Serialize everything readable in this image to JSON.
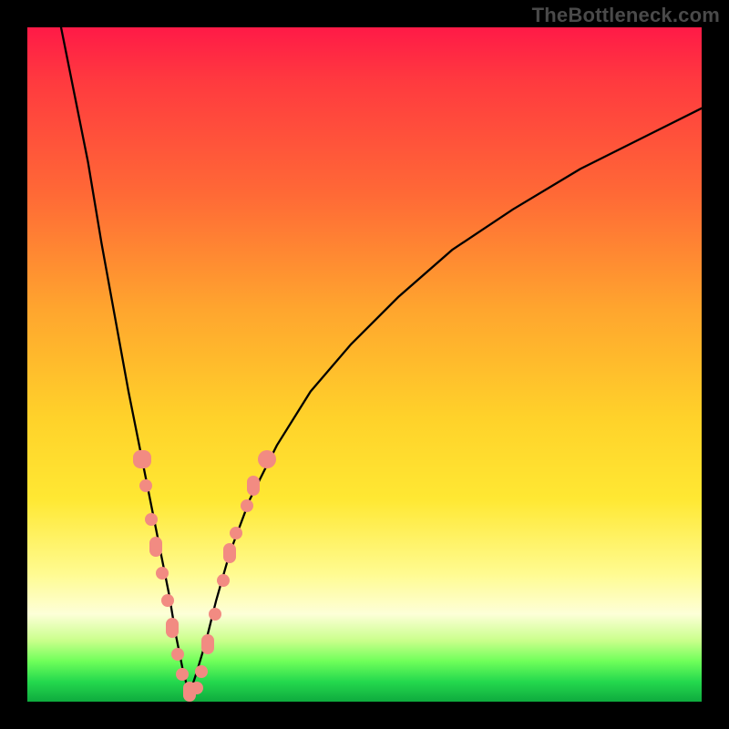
{
  "watermark": "TheBottleneck.com",
  "colors": {
    "frame": "#000000",
    "curve": "#000000",
    "dot": "#f28b82",
    "gradient_stops": [
      "#ff1a47",
      "#ff3a3f",
      "#ff6a36",
      "#ffa62e",
      "#ffd22a",
      "#ffe833",
      "#fffb90",
      "#fdffd8",
      "#c9ff8a",
      "#6fff5a",
      "#25d94e",
      "#0eab3e"
    ]
  },
  "chart_data": {
    "type": "line",
    "title": "",
    "xlabel": "",
    "ylabel": "",
    "xlim": [
      0,
      100
    ],
    "ylim": [
      0,
      100
    ],
    "legend": false,
    "grid": false,
    "notes": "Bottleneck curve: two arms descend to a narrow V at x≈24. Y-axis is bottleneck %, 0 at bottom (green). Salmon markers cluster on both arms below y≈35.",
    "series": [
      {
        "name": "curve_left",
        "x": [
          5,
          7,
          9,
          11,
          13,
          15,
          17,
          18,
          19,
          20,
          21,
          22,
          23,
          24
        ],
        "y": [
          100,
          90,
          80,
          68,
          57,
          46,
          36,
          31,
          26,
          21,
          16,
          10,
          5,
          1
        ]
      },
      {
        "name": "curve_right",
        "x": [
          24,
          25,
          26.5,
          28,
          30,
          33,
          37,
          42,
          48,
          55,
          63,
          72,
          82,
          92,
          100
        ],
        "y": [
          1,
          4,
          9,
          15,
          22,
          30,
          38,
          46,
          53,
          60,
          67,
          73,
          79,
          84,
          88
        ]
      }
    ],
    "markers": [
      {
        "series": "left",
        "x": 17.0,
        "y": 36
      },
      {
        "series": "left",
        "x": 17.5,
        "y": 32
      },
      {
        "series": "left",
        "x": 18.4,
        "y": 27
      },
      {
        "series": "left",
        "x": 19.0,
        "y": 23
      },
      {
        "series": "left",
        "x": 20.0,
        "y": 19
      },
      {
        "series": "left",
        "x": 20.8,
        "y": 15
      },
      {
        "series": "left",
        "x": 21.5,
        "y": 11
      },
      {
        "series": "left",
        "x": 22.3,
        "y": 7
      },
      {
        "series": "left",
        "x": 23.0,
        "y": 4
      },
      {
        "series": "left",
        "x": 24.0,
        "y": 1.5
      },
      {
        "series": "right",
        "x": 25.2,
        "y": 2
      },
      {
        "series": "right",
        "x": 25.8,
        "y": 4.5
      },
      {
        "series": "right",
        "x": 26.8,
        "y": 8.5
      },
      {
        "series": "right",
        "x": 27.8,
        "y": 13
      },
      {
        "series": "right",
        "x": 29.0,
        "y": 18
      },
      {
        "series": "right",
        "x": 30.0,
        "y": 22
      },
      {
        "series": "right",
        "x": 31.0,
        "y": 25
      },
      {
        "series": "right",
        "x": 32.5,
        "y": 29
      },
      {
        "series": "right",
        "x": 33.5,
        "y": 32
      },
      {
        "series": "right",
        "x": 35.5,
        "y": 36
      }
    ]
  }
}
